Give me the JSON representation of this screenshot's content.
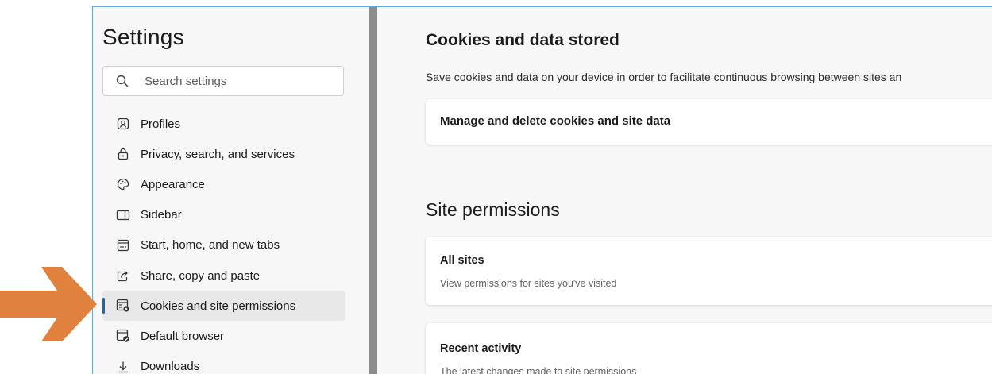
{
  "settings": {
    "title": "Settings",
    "search": {
      "placeholder": "Search settings"
    },
    "nav": [
      {
        "label": "Profiles",
        "icon": "profiles-icon"
      },
      {
        "label": "Privacy, search, and services",
        "icon": "lock-icon"
      },
      {
        "label": "Appearance",
        "icon": "palette-icon"
      },
      {
        "label": "Sidebar",
        "icon": "sidebar-icon"
      },
      {
        "label": "Start, home, and new tabs",
        "icon": "start-home-icon"
      },
      {
        "label": "Share, copy and paste",
        "icon": "share-icon"
      },
      {
        "label": "Cookies and site permissions",
        "icon": "cookies-permissions-icon",
        "active": true
      },
      {
        "label": "Default browser",
        "icon": "default-browser-icon"
      },
      {
        "label": "Downloads",
        "icon": "download-icon"
      }
    ]
  },
  "main": {
    "cookies": {
      "heading": "Cookies and data stored",
      "description": "Save cookies and data on your device in order to facilitate continuous browsing between sites an",
      "manage_label": "Manage and delete cookies and site data"
    },
    "permissions": {
      "heading": "Site permissions",
      "all_sites": {
        "title": "All sites",
        "subtitle": "View permissions for sites you've visited"
      },
      "recent": {
        "title": "Recent activity",
        "subtitle": "The latest changes made to site permissions"
      }
    }
  },
  "colors": {
    "accent": "#0f6cbd",
    "arrow": "#e0823d",
    "divider": "#8c8c8c"
  }
}
